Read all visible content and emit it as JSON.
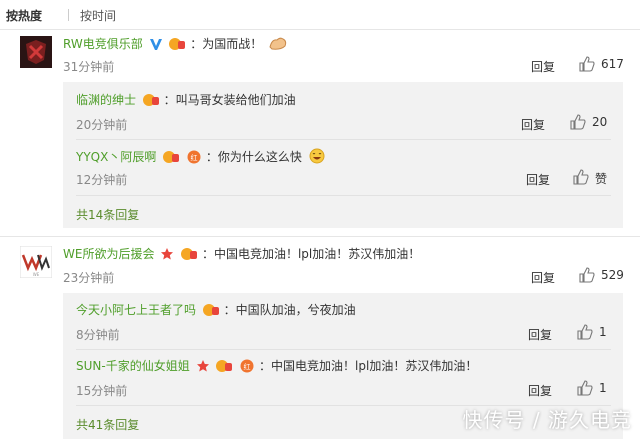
{
  "sort": {
    "hot": "按热度",
    "time": "按时间"
  },
  "comments": [
    {
      "user": "RW电竞俱乐部",
      "text": "：为国而战！",
      "time": "31分钟前",
      "reply": "回复",
      "likes": "617",
      "replies": [
        {
          "user": "临渊的绅士",
          "text": "：叫马哥女装给他们加油",
          "time": "20分钟前",
          "reply": "回复",
          "likes": "20"
        },
        {
          "user": "YYQX丶阿辰啊",
          "text": "：你为什么这么快",
          "time": "12分钟前",
          "reply": "回复",
          "likes": "赞"
        }
      ],
      "more": "共14条回复"
    },
    {
      "user": "WE所欲为后援会",
      "text": "：中国电竞加油！lpl加油！苏汉伟加油！",
      "time": "23分钟前",
      "reply": "回复",
      "likes": "529",
      "replies": [
        {
          "user": "今天小阿七上王者了吗",
          "text": "：中国队加油，兮夜加油",
          "time": "8分钟前",
          "reply": "回复",
          "likes": "1"
        },
        {
          "user": "SUN-千家的仙女姐姐",
          "text": "：中国电竞加油！lpl加油！苏汉伟加油！",
          "time": "15分钟前",
          "reply": "回复",
          "likes": "1"
        }
      ],
      "more": "共41条回复"
    }
  ],
  "watermark": "快传号 / 游久电竞",
  "colors": {
    "username": "#4f9e2a",
    "subpanel": "#f2f2f2",
    "text": "#333333",
    "meta": "#888888"
  }
}
